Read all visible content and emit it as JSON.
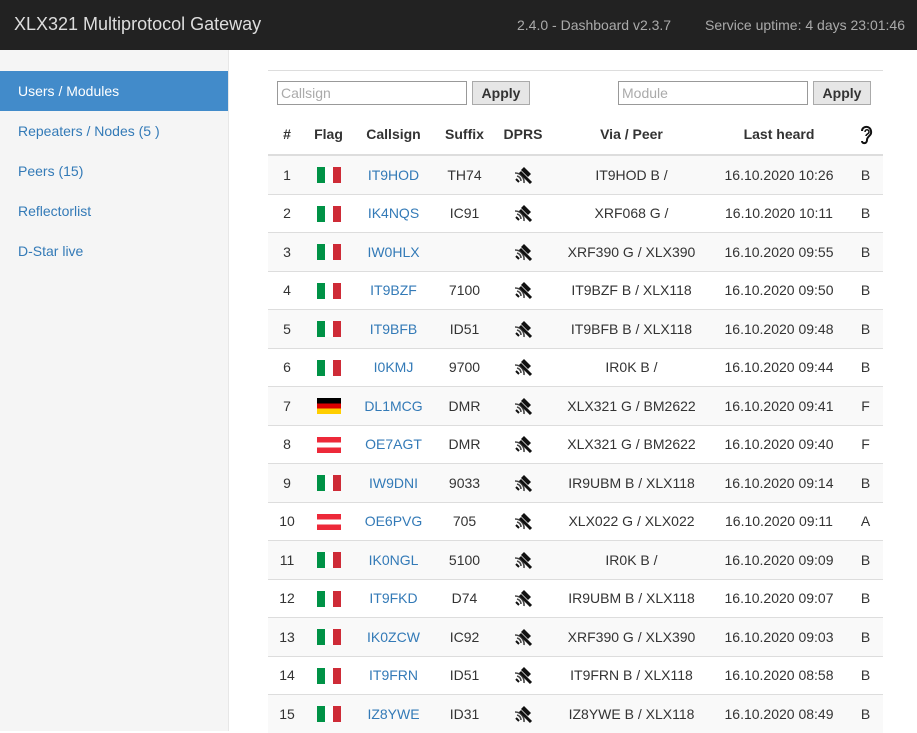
{
  "header": {
    "title": "XLX321 Multiprotocol Gateway",
    "version": "2.4.0 - Dashboard v2.3.7",
    "uptime": "Service uptime: 4 days 23:01:46"
  },
  "sidebar": {
    "items": [
      {
        "label": "Users / Modules",
        "active": true
      },
      {
        "label": "Repeaters / Nodes (5 )",
        "active": false
      },
      {
        "label": "Peers (15)",
        "active": false
      },
      {
        "label": "Reflectorlist",
        "active": false
      },
      {
        "label": "D-Star live",
        "active": false
      }
    ]
  },
  "filters": {
    "callsign_placeholder": "Callsign",
    "module_placeholder": "Module",
    "apply_label": "Apply"
  },
  "table": {
    "headers": {
      "num": "#",
      "flag": "Flag",
      "callsign": "Callsign",
      "suffix": "Suffix",
      "dprs": "DPRS",
      "via": "Via / Peer",
      "last_heard": "Last heard",
      "module_icon": "ear-icon"
    },
    "rows": [
      {
        "num": "1",
        "flag": "it",
        "callsign": "IT9HOD",
        "suffix": "TH74",
        "via": "IT9HOD B /",
        "last_heard": "16.10.2020 10:26",
        "module": "B"
      },
      {
        "num": "2",
        "flag": "it",
        "callsign": "IK4NQS",
        "suffix": "IC91",
        "via": "XRF068 G /",
        "last_heard": "16.10.2020 10:11",
        "module": "B"
      },
      {
        "num": "3",
        "flag": "it",
        "callsign": "IW0HLX",
        "suffix": "",
        "via": "XRF390 G / XLX390",
        "last_heard": "16.10.2020 09:55",
        "module": "B"
      },
      {
        "num": "4",
        "flag": "it",
        "callsign": "IT9BZF",
        "suffix": "7100",
        "via": "IT9BZF B / XLX118",
        "last_heard": "16.10.2020 09:50",
        "module": "B"
      },
      {
        "num": "5",
        "flag": "it",
        "callsign": "IT9BFB",
        "suffix": "ID51",
        "via": "IT9BFB B / XLX118",
        "last_heard": "16.10.2020 09:48",
        "module": "B"
      },
      {
        "num": "6",
        "flag": "it",
        "callsign": "I0KMJ",
        "suffix": "9700",
        "via": "IR0K B /",
        "last_heard": "16.10.2020 09:44",
        "module": "B"
      },
      {
        "num": "7",
        "flag": "de",
        "callsign": "DL1MCG",
        "suffix": "DMR",
        "via": "XLX321 G / BM2622",
        "last_heard": "16.10.2020 09:41",
        "module": "F"
      },
      {
        "num": "8",
        "flag": "at",
        "callsign": "OE7AGT",
        "suffix": "DMR",
        "via": "XLX321 G / BM2622",
        "last_heard": "16.10.2020 09:40",
        "module": "F"
      },
      {
        "num": "9",
        "flag": "it",
        "callsign": "IW9DNI",
        "suffix": "9033",
        "via": "IR9UBM B / XLX118",
        "last_heard": "16.10.2020 09:14",
        "module": "B"
      },
      {
        "num": "10",
        "flag": "at",
        "callsign": "OE6PVG",
        "suffix": "705",
        "via": "XLX022 G / XLX022",
        "last_heard": "16.10.2020 09:11",
        "module": "A"
      },
      {
        "num": "11",
        "flag": "it",
        "callsign": "IK0NGL",
        "suffix": "5100",
        "via": "IR0K B /",
        "last_heard": "16.10.2020 09:09",
        "module": "B"
      },
      {
        "num": "12",
        "flag": "it",
        "callsign": "IT9FKD",
        "suffix": "D74",
        "via": "IR9UBM B / XLX118",
        "last_heard": "16.10.2020 09:07",
        "module": "B"
      },
      {
        "num": "13",
        "flag": "it",
        "callsign": "IK0ZCW",
        "suffix": "IC92",
        "via": "XRF390 G / XLX390",
        "last_heard": "16.10.2020 09:03",
        "module": "B"
      },
      {
        "num": "14",
        "flag": "it",
        "callsign": "IT9FRN",
        "suffix": "ID51",
        "via": "IT9FRN B / XLX118",
        "last_heard": "16.10.2020 08:58",
        "module": "B"
      },
      {
        "num": "15",
        "flag": "it",
        "callsign": "IZ8YWE",
        "suffix": "ID31",
        "via": "IZ8YWE B / XLX118",
        "last_heard": "16.10.2020 08:49",
        "module": "B"
      }
    ]
  },
  "icons": {
    "dprs": "satellite-icon",
    "flag": "flag-icon"
  },
  "colors": {
    "navbar": "#222222",
    "accent": "#428bca",
    "link": "#337ab7"
  }
}
